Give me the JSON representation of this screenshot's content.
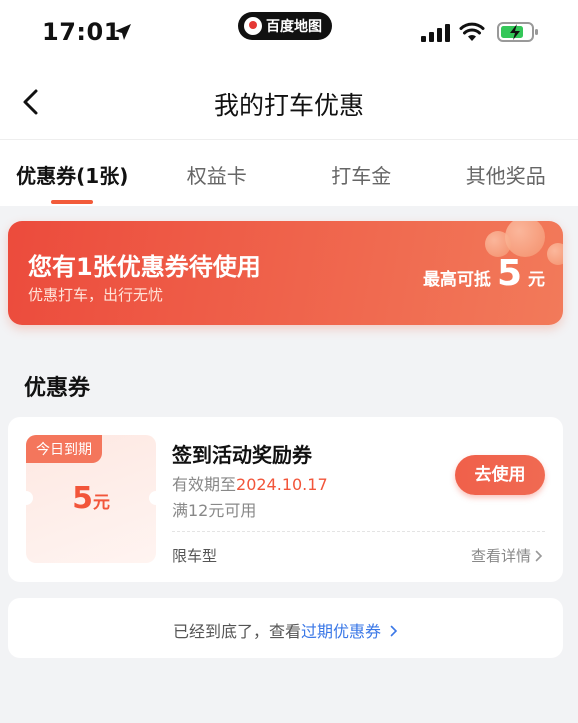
{
  "status_bar": {
    "time": "17:01",
    "app_name": "百度地图"
  },
  "nav": {
    "title": "我的打车优惠"
  },
  "tabs": [
    {
      "label": "优惠券(1张)",
      "active": true
    },
    {
      "label": "权益卡",
      "active": false
    },
    {
      "label": "打车金",
      "active": false
    },
    {
      "label": "其他奖品",
      "active": false
    }
  ],
  "banner": {
    "title": "您有1张优惠券待使用",
    "subtitle": "优惠打车，出行无忧",
    "max_label": "最高可抵",
    "max_amount": "5",
    "max_unit": "元"
  },
  "section": {
    "title": "优惠券"
  },
  "coupon": {
    "badge": "今日到期",
    "amount": "5",
    "unit": "元",
    "title": "签到活动奖励券",
    "expire_prefix": "有效期至",
    "expire_date": "2024.10.17",
    "condition": "满12元可用",
    "use_label": "去使用",
    "limit_label": "限车型",
    "detail_label": "查看详情"
  },
  "footer": {
    "text": "已经到底了，查看",
    "link": "过期优惠券"
  },
  "colors": {
    "accent": "#f25b3a",
    "link": "#3b78e7",
    "background": "#f2f3f5"
  }
}
